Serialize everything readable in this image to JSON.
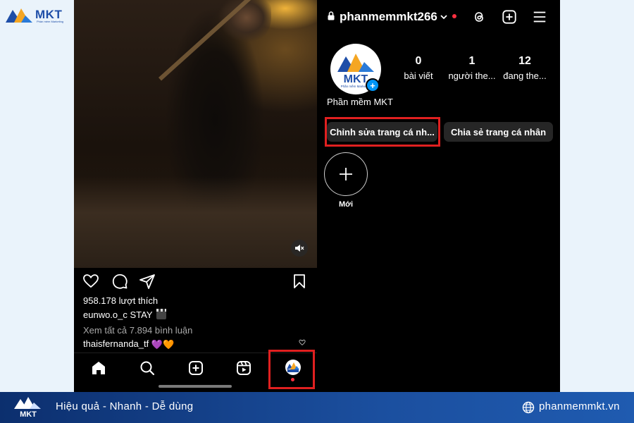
{
  "brand": {
    "logo_text": "MKT",
    "logo_tagline": "Phần mềm Marketing",
    "slogan": "Hiệu quả - Nhanh  - Dễ dùng",
    "website": "phanmemmkt.vn",
    "colors": {
      "primary": "#1e4ea8",
      "accent": "#f5a623",
      "banner_bg": "#1b4f9f"
    }
  },
  "post": {
    "likes": "958.178 lượt thích",
    "author": "eunwo.o_c",
    "caption": "STAY",
    "view_comments": "Xem tất cả 7.894 bình luận",
    "comment_user": "thaisfernanda_tf",
    "comment_emoji": "💜🧡",
    "icons": [
      "heart-icon",
      "comment-icon",
      "share-icon",
      "bookmark-icon",
      "mute-icon"
    ]
  },
  "bottom_nav": {
    "items": [
      "home-icon",
      "search-icon",
      "create-icon",
      "reels-icon",
      "profile-avatar"
    ],
    "highlight_color": "#e02020"
  },
  "profile": {
    "username": "phanmemmkt266",
    "display_name": "Phần mềm MKT",
    "stats": [
      {
        "value": "0",
        "label": "bài viết"
      },
      {
        "value": "1",
        "label": "người the..."
      },
      {
        "value": "12",
        "label": "đang the..."
      }
    ],
    "edit_button": "Chỉnh sửa trang cá nh...",
    "share_button": "Chia sẻ trang cá nhân",
    "new_highlight_label": "Mới",
    "header_icons": [
      "threads-icon",
      "create-icon",
      "menu-icon"
    ],
    "notification_color": "#ff3040"
  }
}
